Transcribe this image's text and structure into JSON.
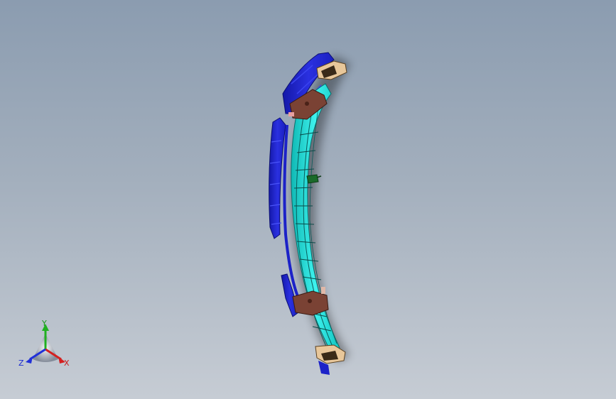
{
  "viewport": {
    "background_top": "#8b9cb0",
    "background_bottom": "#c6ccd4"
  },
  "model": {
    "colors": {
      "cover_blue": "#1c22c8",
      "rail_cyan": "#18e0dc",
      "bracket_brown": "#7a4234",
      "end_block": "#e8c79a",
      "cable_green": "#1a6a2a"
    }
  },
  "triad": {
    "y_label": "Y",
    "x_label": "X",
    "z_label": "Z",
    "colors": {
      "x": "#d42020",
      "y": "#20b020",
      "z": "#2030d8"
    }
  }
}
